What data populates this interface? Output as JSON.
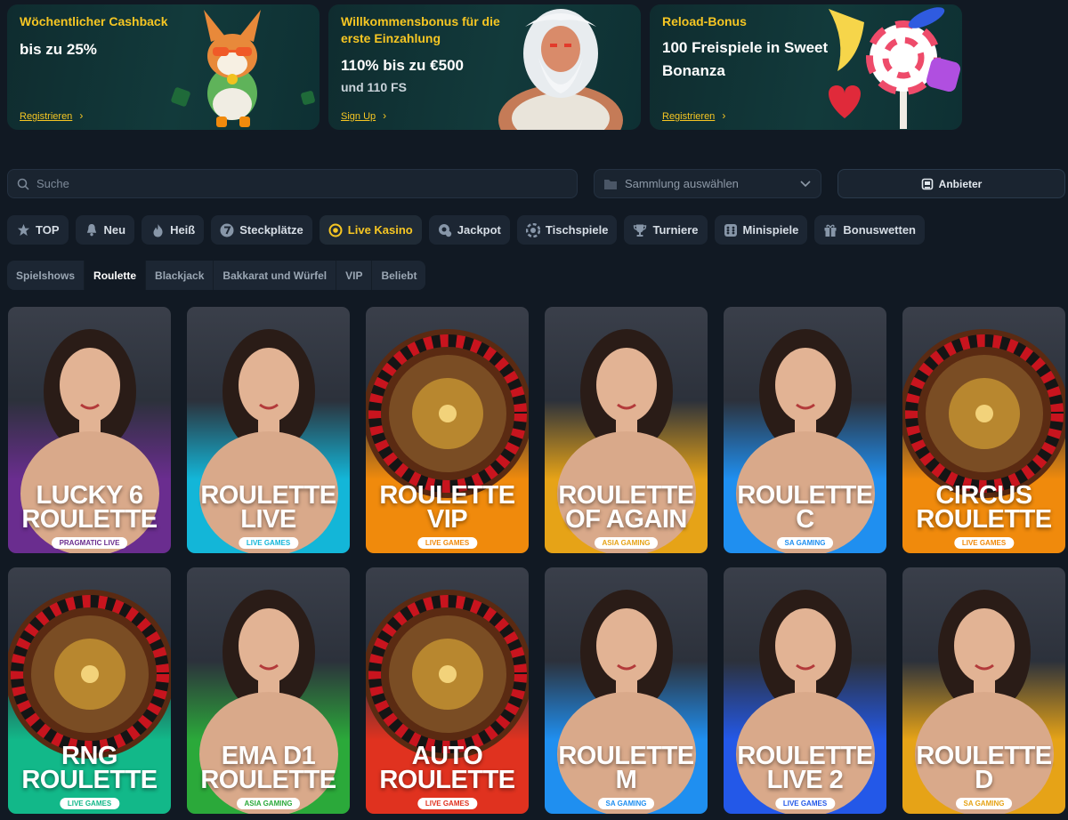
{
  "promos": [
    {
      "title": "Wöchentlicher Cashback",
      "headline": "bis zu 25%",
      "sub": "",
      "link": "Registrieren",
      "art": "corgi-mascot"
    },
    {
      "title": "Willkommensbonus für die erste Einzahlung",
      "headline": "110% bis zu €500",
      "sub": "und 110 FS",
      "link": "Sign Up",
      "art": "zeus-character"
    },
    {
      "title": "Reload-Bonus",
      "headline": "100 Freispiele in Sweet Bonanza",
      "sub": "",
      "link": "Registrieren",
      "art": "candy-lollipop"
    }
  ],
  "search": {
    "placeholder": "Suche"
  },
  "collection": {
    "placeholder": "Sammlung auswählen"
  },
  "provider": {
    "label": "Anbieter"
  },
  "categories": [
    {
      "label": "TOP",
      "icon": "star-icon"
    },
    {
      "label": "Neu",
      "icon": "bell-icon"
    },
    {
      "label": "Heiß",
      "icon": "flame-icon"
    },
    {
      "label": "Steckplätze",
      "icon": "seven-icon"
    },
    {
      "label": "Live Kasino",
      "icon": "live-chip-icon",
      "active": true
    },
    {
      "label": "Jackpot",
      "icon": "jackpot-icon"
    },
    {
      "label": "Tischspiele",
      "icon": "table-chip-icon"
    },
    {
      "label": "Turniere",
      "icon": "trophy-icon"
    },
    {
      "label": "Minispiele",
      "icon": "dice-icon"
    },
    {
      "label": "Bonuswetten",
      "icon": "gift-icon"
    }
  ],
  "subcategories": [
    {
      "label": "Spielshows"
    },
    {
      "label": "Roulette",
      "active": true
    },
    {
      "label": "Blackjack"
    },
    {
      "label": "Bakkarat und Würfel"
    },
    {
      "label": "VIP"
    },
    {
      "label": "Beliebt"
    }
  ],
  "games": [
    {
      "name": "LUCKY 6 ROULETTE",
      "provider": "PRAGMATIC LIVE",
      "color": "#6a2d8f",
      "subject": "dealer"
    },
    {
      "name": "ROULETTE LIVE",
      "provider": "LIVE GAMES",
      "color": "#13b6d8",
      "subject": "dealer"
    },
    {
      "name": "ROULETTE VIP",
      "provider": "LIVE GAMES",
      "color": "#f08a0c",
      "subject": "wheel"
    },
    {
      "name": "ROULETTE OF AGAIN",
      "provider": "ASIA GAMING",
      "color": "#e6a317",
      "subject": "dealer"
    },
    {
      "name": "ROULETTE C",
      "provider": "SA GAMING",
      "color": "#1f8ff0",
      "subject": "dealer"
    },
    {
      "name": "CIRCUS ROULETTE",
      "provider": "LIVE GAMES",
      "color": "#f08a0c",
      "subject": "wheel"
    },
    {
      "name": "RNG ROULETTE",
      "provider": "LIVE GAMES",
      "color": "#12b889",
      "subject": "wheel"
    },
    {
      "name": "EMA D1 ROULETTE",
      "provider": "ASIA GAMING",
      "color": "#2ba93a",
      "subject": "dealer"
    },
    {
      "name": "AUTO ROULETTE",
      "provider": "LIVE GAMES",
      "color": "#e0321f",
      "subject": "wheel"
    },
    {
      "name": "ROULETTE M",
      "provider": "SA GAMING",
      "color": "#1f8ff0",
      "subject": "dealer"
    },
    {
      "name": "ROULETTE LIVE 2",
      "provider": "LIVE GAMES",
      "color": "#2358e8",
      "subject": "dealer"
    },
    {
      "name": "ROULETTE D",
      "provider": "SA GAMING",
      "color": "#e6a317",
      "subject": "dealer"
    }
  ]
}
